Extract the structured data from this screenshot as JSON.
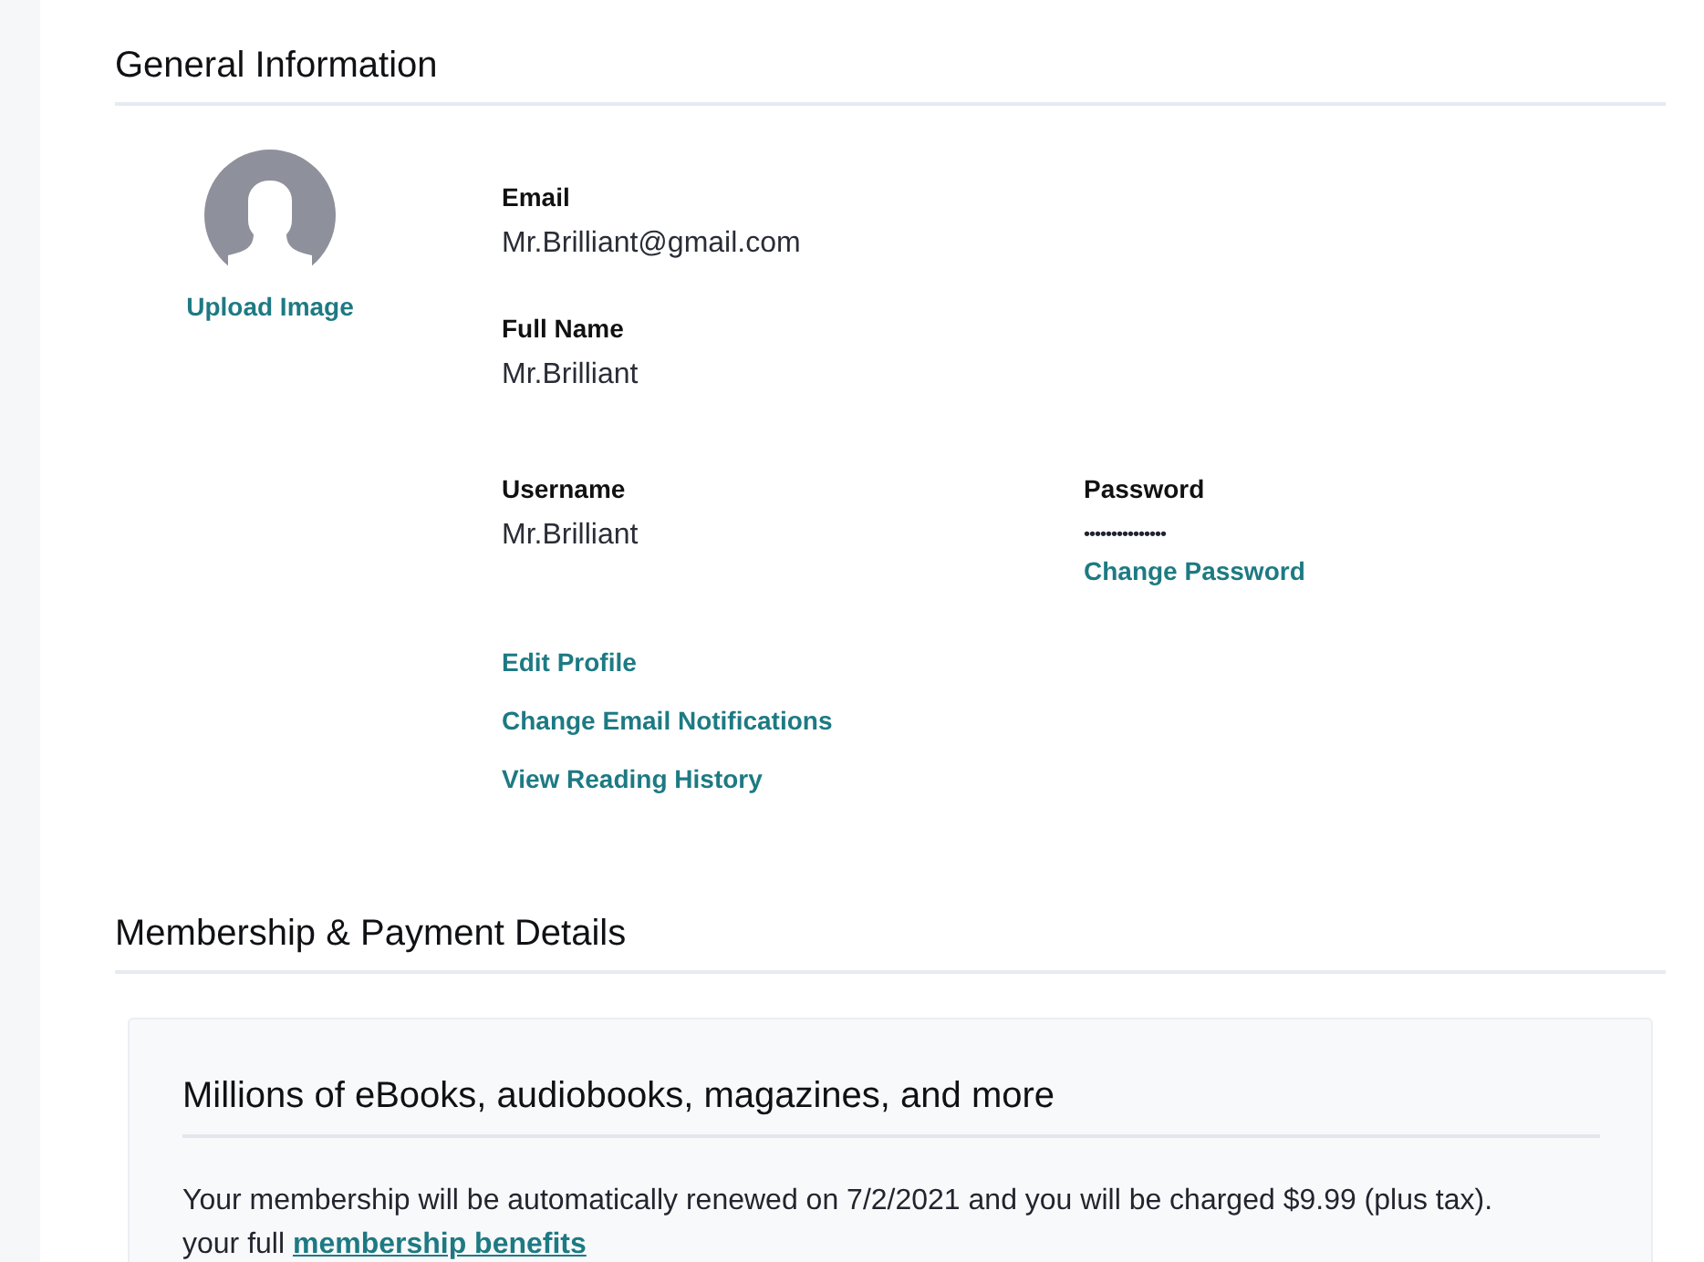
{
  "general_information": {
    "title": "General Information",
    "avatar": {
      "upload_link": "Upload Image"
    },
    "field_rows": [
      [
        {
          "kind": "text",
          "label": "Email",
          "value": "Mr.Brilliant@gmail.com"
        }
      ],
      [
        {
          "kind": "text",
          "label": "Full Name",
          "value": "Mr.Brilliant"
        }
      ],
      [
        {
          "kind": "text",
          "label": "Username",
          "value": "Mr.Brilliant"
        },
        {
          "kind": "password",
          "label": "Password",
          "value": "•••••••••••••••",
          "link": "Change Password"
        }
      ]
    ],
    "links": [
      "Edit Profile",
      "Change Email Notifications",
      "View Reading History"
    ]
  },
  "membership": {
    "title": "Membership & Payment Details",
    "card": {
      "title": "Millions of eBooks, audiobooks, magazines, and more",
      "notice": "Your membership will be automatically renewed on 7/2/2021 and you will be charged $9.99 (plus tax).",
      "notice_line_2": "your full",
      "benefits_link": "membership benefits"
    }
  }
}
